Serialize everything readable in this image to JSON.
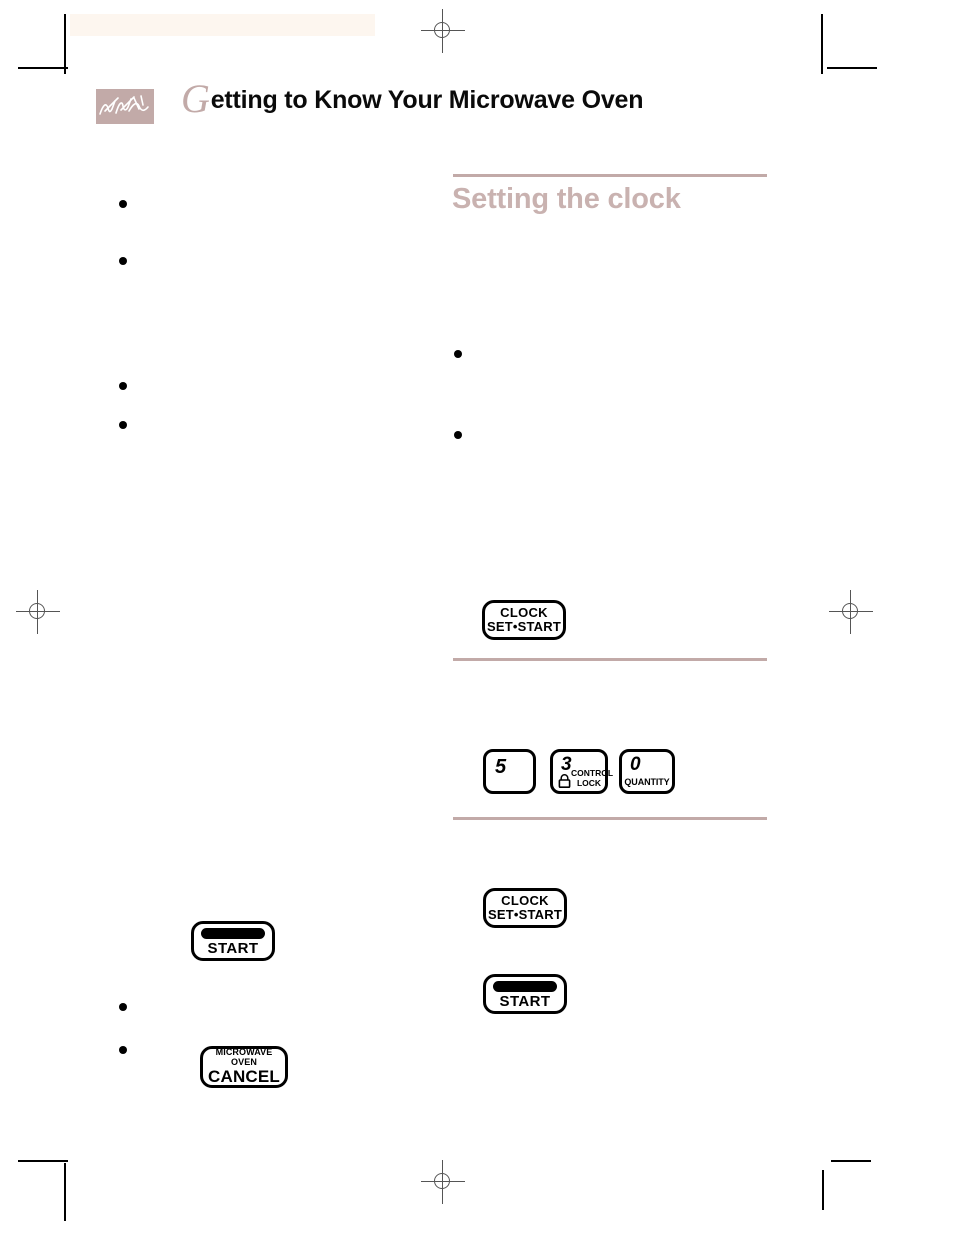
{
  "header": {
    "logo_name": "signature-logo",
    "title_dropcap": "G",
    "title_rest": "etting to Know Your Microwave Oven"
  },
  "section": {
    "heading": "Setting the clock"
  },
  "buttons": {
    "clock_set_start": {
      "line1": "CLOCK",
      "line2": "SET•START"
    },
    "start": {
      "label": "START"
    },
    "cancel": {
      "line1": "MICROWAVE OVEN",
      "line2": "CANCEL"
    }
  },
  "keypad": [
    {
      "name": "key-5",
      "digit": "5",
      "label_lines": [],
      "icon": ""
    },
    {
      "name": "key-3-control-lock",
      "digit": "3",
      "label_lines": [
        "CONTROL",
        "LOCK"
      ],
      "icon": "padlock-icon"
    },
    {
      "name": "key-0-quantity",
      "digit": "0",
      "label_lines": [
        "QUANTITY"
      ],
      "icon": ""
    }
  ],
  "colors": {
    "mauve": "#c2aaa8",
    "heading_mauve": "#c9b2b0",
    "cream_band": "#fdf6ef",
    "ink": "#000000",
    "reg_mark": "#555555"
  },
  "print_marks": {
    "registration_mark_name": "registration-mark",
    "crop_mark_name": "crop-mark",
    "color_band_name": "color-calibration-band"
  }
}
